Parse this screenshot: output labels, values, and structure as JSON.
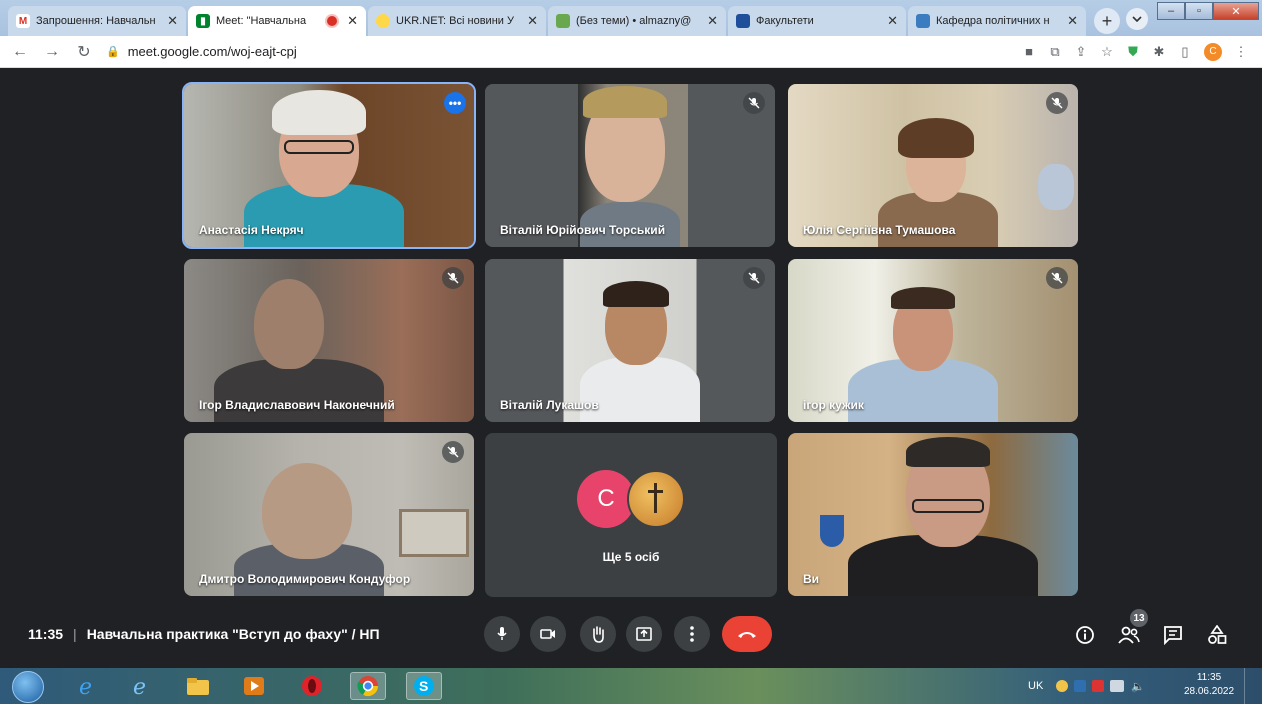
{
  "browser": {
    "tabs": [
      {
        "title": "Запрошення: Навчальн",
        "icon": "gmail-icon",
        "active": false
      },
      {
        "title": "Meet: \"Навчальна",
        "icon": "meet-icon",
        "active": true,
        "recording": true
      },
      {
        "title": "UKR.NET: Всі новини У",
        "icon": "ukrnet-icon",
        "active": false
      },
      {
        "title": "(Без теми) • almazny@",
        "icon": "mail-icon",
        "active": false
      },
      {
        "title": "Факультети",
        "icon": "university-icon",
        "active": false
      },
      {
        "title": "Кафедра політичних н",
        "icon": "department-icon",
        "active": false
      }
    ],
    "new_tab": "+",
    "url": "meet.google.com/woj-eajt-cpj",
    "profile_letter": "C"
  },
  "participants": [
    {
      "name": "Анастасія Некряч",
      "muted": false,
      "speaking": true
    },
    {
      "name": "Віталій Юрійович Торський",
      "muted": true
    },
    {
      "name": "Юлія Сергіївна Тумашова",
      "muted": true
    },
    {
      "name": "Ігор Владиславович Наконечний",
      "muted": true
    },
    {
      "name": "Віталій Лукашов",
      "muted": true
    },
    {
      "name": "ігор кужик",
      "muted": true
    },
    {
      "name": "Дмитро Володимирович Кондуфор",
      "muted": true
    },
    {
      "name": "Ви",
      "muted": false
    }
  ],
  "others": {
    "avatar_letter": "C",
    "label": "Ще 5 осіб"
  },
  "meeting": {
    "time": "11:35",
    "separator": "|",
    "title": "Навчальна практика \"Вступ до фаху\" / НП"
  },
  "controls": [
    "mic-icon",
    "camera-icon",
    "raise-hand-icon",
    "present-icon",
    "more-options-icon",
    "end-call-icon"
  ],
  "right_controls": {
    "people_count": "13"
  },
  "taskbar": {
    "lang": "UK",
    "clock_time": "11:35",
    "clock_date": "28.06.2022"
  },
  "colors": {
    "meet_bg": "#202124",
    "tile_bg": "#3c4043",
    "end_call": "#ea4335",
    "accent": "#1a73e8"
  }
}
